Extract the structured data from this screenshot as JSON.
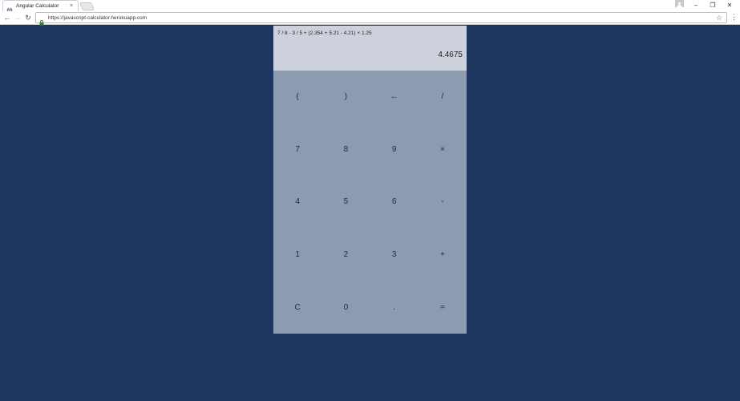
{
  "browser": {
    "tab_title": "Angular Calculator",
    "tab_close": "×",
    "url": "https://javascript-calculator.herokuapp.com",
    "window_controls": {
      "minimize": "–",
      "restore": "❐",
      "close": "✕"
    },
    "nav": {
      "back": "←",
      "forward": "→",
      "reload": "↻"
    },
    "bookmark_star": "☆",
    "menu": "⋮"
  },
  "calculator": {
    "expression": "7 / 8 - 3 / 5 + (2.354 + 5.21 - 4.21) × 1.25",
    "result": "4.4675",
    "keys": [
      [
        "(",
        ")",
        "←",
        "/"
      ],
      [
        "7",
        "8",
        "9",
        "×"
      ],
      [
        "4",
        "5",
        "6",
        "-"
      ],
      [
        "1",
        "2",
        "3",
        "+"
      ],
      [
        "C",
        "0",
        ".",
        "="
      ]
    ]
  },
  "colors": {
    "page_background": "#1e355e",
    "display_background": "#ccd1dc",
    "keypad_background": "#8d9bb0"
  }
}
